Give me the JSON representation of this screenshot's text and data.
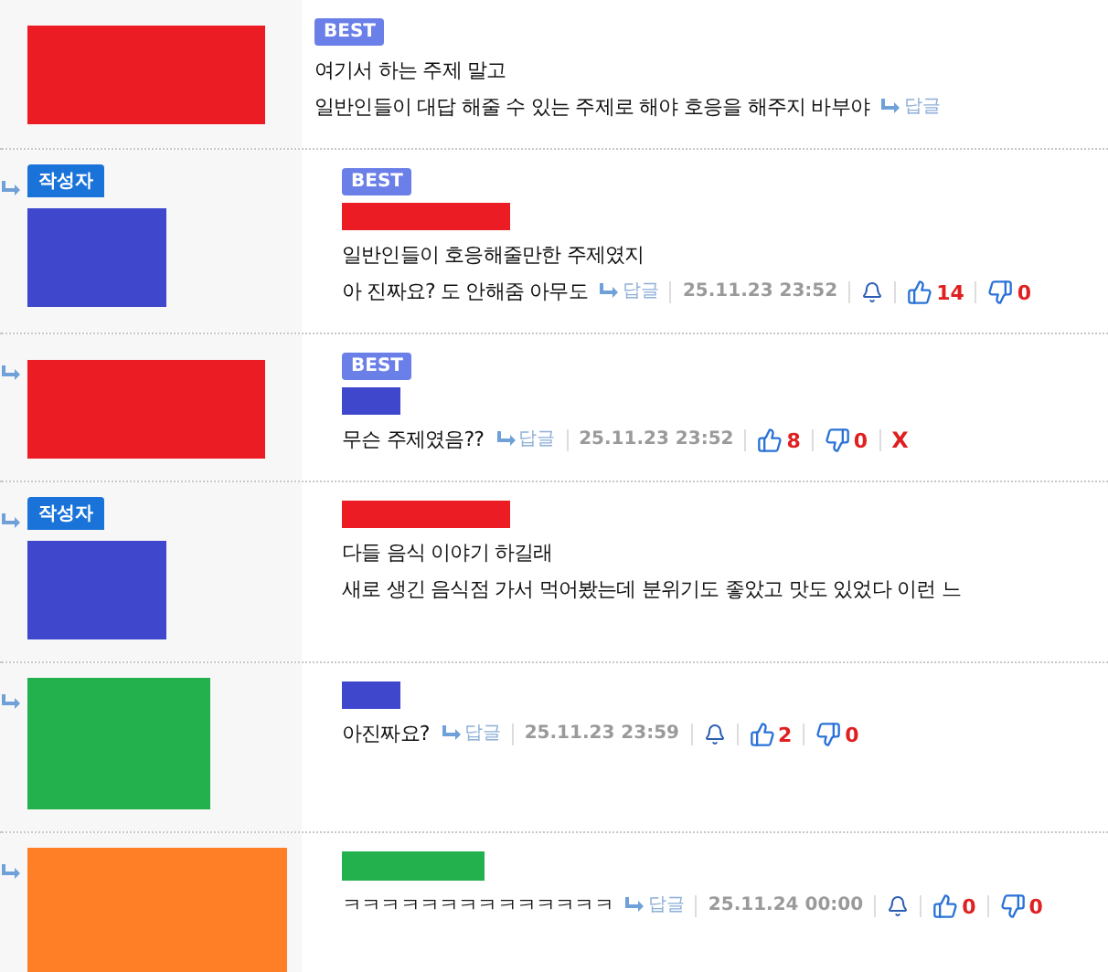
{
  "comments": [
    {
      "reply": false,
      "avatar": {
        "kind": "wide",
        "color": "#ec1c24"
      },
      "best": "BEST",
      "lines": [
        "여기서 하는 주제 말고",
        "일반인들이 대답 해줄 수 있는 주제로 해야 호응을 해주지 바부야"
      ],
      "reply_link": "답글"
    },
    {
      "reply": true,
      "author_badge": "작성자",
      "avatar": {
        "kind": "square",
        "color": "#3f48cc"
      },
      "best": "BEST",
      "name": {
        "kind": "long",
        "color": "#ec1c24"
      },
      "lines": [
        "일반인들이 호응해줄만한 주제였지",
        "아 진짜요? 도 안해줌 아무도"
      ],
      "reply_link": "답글",
      "date": "25.11.23 23:52",
      "bell": true,
      "likes": "14",
      "dislikes": "0"
    },
    {
      "reply": true,
      "avatar": {
        "kind": "wide",
        "color": "#ec1c24"
      },
      "best": "BEST",
      "name": {
        "kind": "short",
        "color": "#3f48cc"
      },
      "lines": [
        "무슨 주제였음??"
      ],
      "reply_link": "답글",
      "date": "25.11.23 23:52",
      "bell": false,
      "likes": "8",
      "dislikes": "0",
      "delete": "X"
    },
    {
      "reply": true,
      "author_badge": "작성자",
      "avatar": {
        "kind": "square",
        "color": "#3f48cc"
      },
      "name": {
        "kind": "long",
        "color": "#ec1c24"
      },
      "lines": [
        "다들 음식 이야기 하길래",
        "새로 생긴 음식점 가서 먹어봤는데 분위기도 좋았고 맛도 있었다 이런 느"
      ]
    },
    {
      "reply": true,
      "avatar": {
        "kind": "tall",
        "color": "#22b14c"
      },
      "name": {
        "kind": "short",
        "color": "#3f48cc"
      },
      "lines": [
        "아진짜요?"
      ],
      "reply_link": "답글",
      "date": "25.11.23 23:59",
      "bell": true,
      "likes": "2",
      "dislikes": "0"
    },
    {
      "reply": true,
      "avatar": {
        "kind": "big",
        "color": "#ff7f27"
      },
      "name": {
        "kind": "medium",
        "color": "#22b14c"
      },
      "lines": [
        "ㅋㅋㅋㅋㅋㅋㅋㅋㅋㅋㅋㅋㅋㅋ"
      ],
      "reply_link": "답글",
      "date": "25.11.24 00:00",
      "bell": true,
      "likes": "0",
      "dislikes": "0"
    }
  ]
}
